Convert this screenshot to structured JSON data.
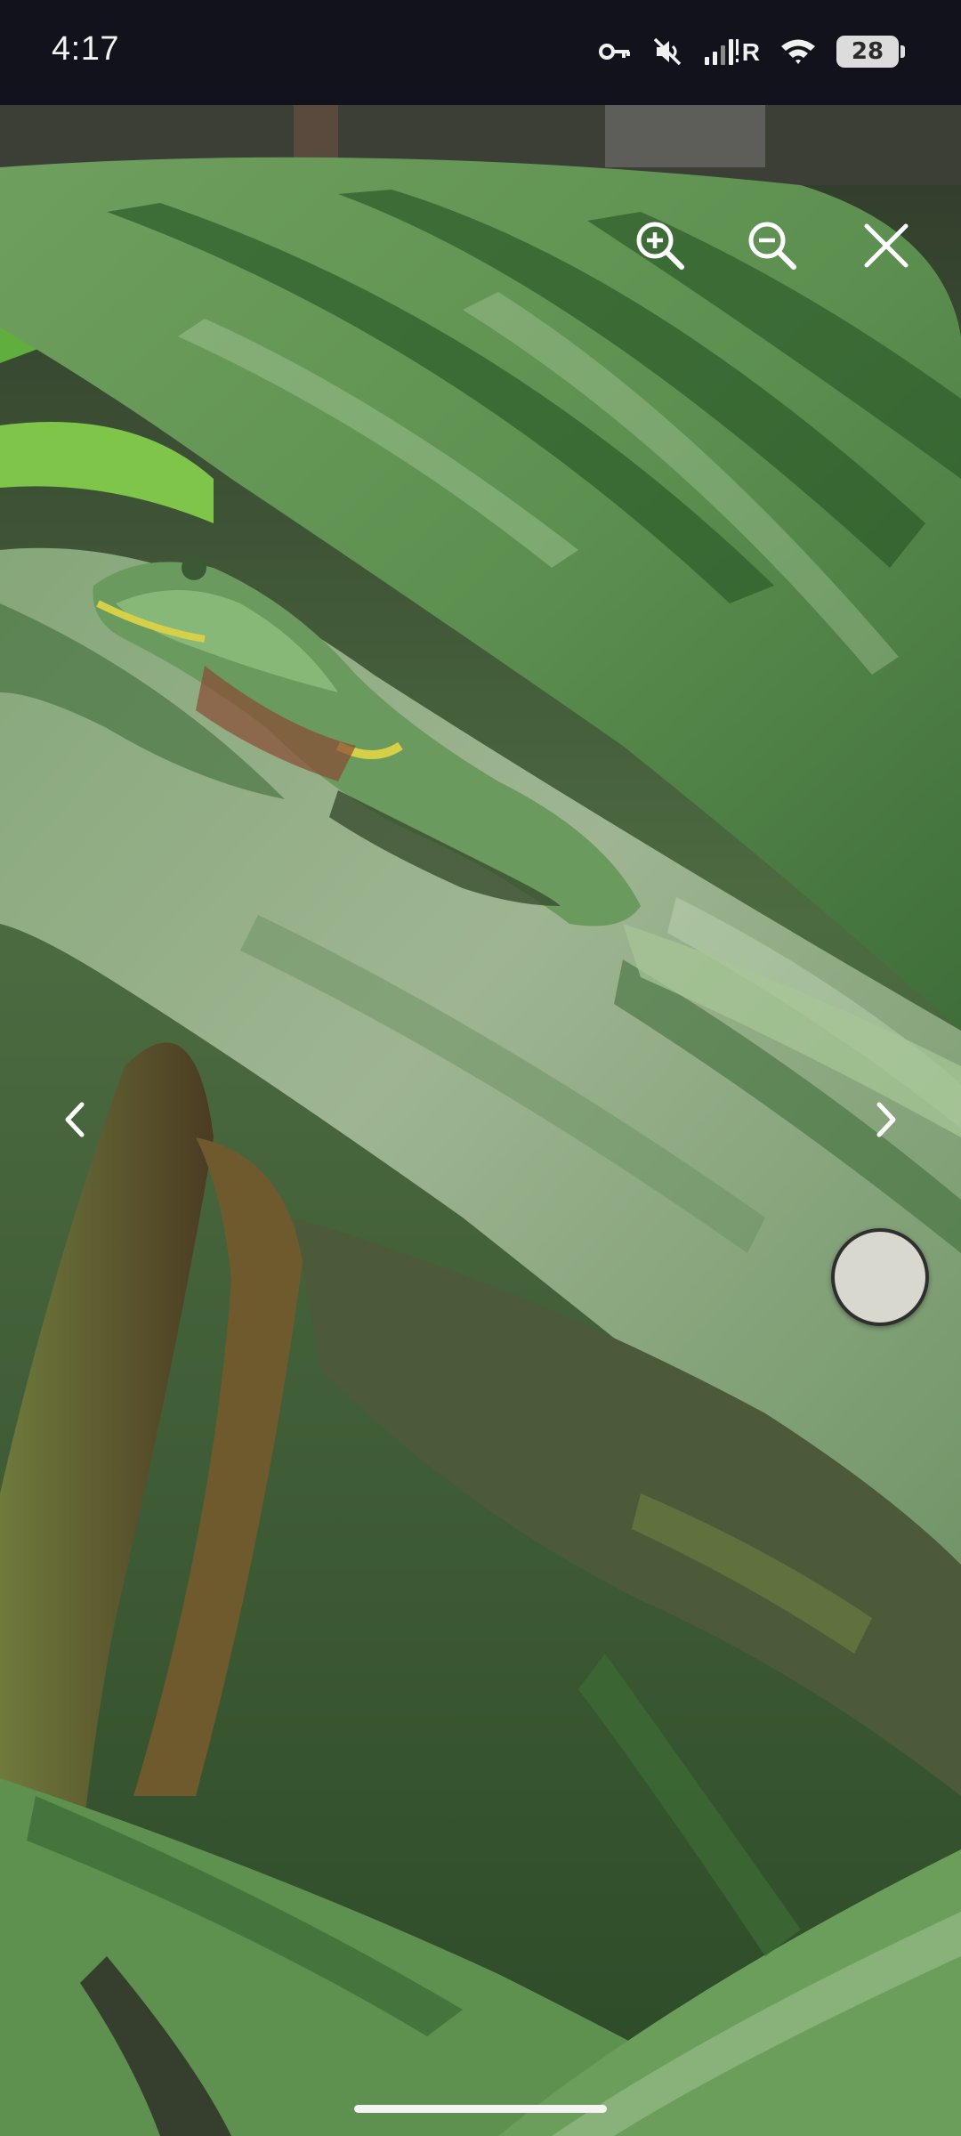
{
  "status_bar": {
    "time": "4:17",
    "network_label": "R",
    "battery_level": "28",
    "icons": [
      "vpn-key-icon",
      "mute-icon",
      "signal-icon",
      "wifi-icon",
      "battery-icon"
    ]
  },
  "viewer": {
    "controls": [
      "zoom-in-icon",
      "zoom-out-icon",
      "close-icon",
      "previous-chevron-icon",
      "next-chevron-icon"
    ],
    "accent_color": "#ffffff",
    "capture_button_color": "#d8d8cf"
  }
}
